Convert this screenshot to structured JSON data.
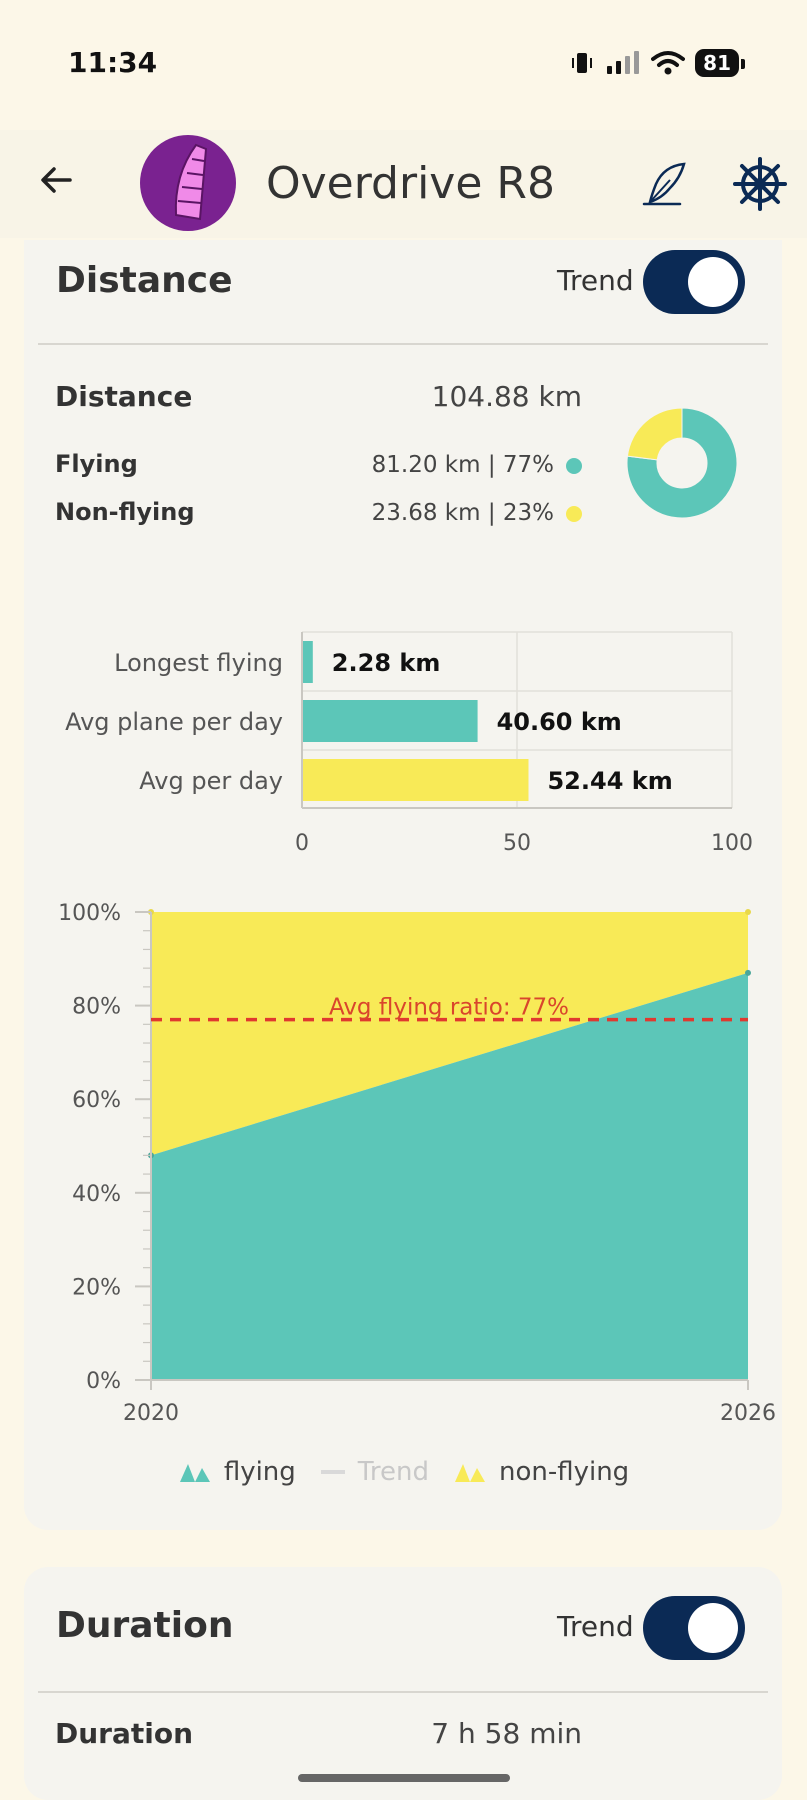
{
  "status_bar": {
    "time": "11:34",
    "battery": "81"
  },
  "app_bar": {
    "title": "Overdrive R8",
    "icons": [
      "back-arrow-icon",
      "kite-avatar",
      "quill-icon",
      "helm-icon"
    ]
  },
  "distance_card": {
    "title": "Distance",
    "trend_label": "Trend",
    "trend_on": true,
    "summary": {
      "total_label": "Distance",
      "total_value": "104.88 km",
      "flying_label": "Flying",
      "flying_value": "81.20 km | 77%",
      "nonflying_label": "Non-flying",
      "nonflying_value": "23.68 km | 23%"
    }
  },
  "duration_card": {
    "title": "Duration",
    "trend_label": "Trend",
    "trend_on": true,
    "total_label": "Duration",
    "total_value": "7 h 58 min"
  },
  "colors": {
    "flying": "#5cc6b8",
    "nonflying": "#f8ea57",
    "navy": "#0b2a55",
    "avg_line": "#e0392f"
  },
  "chart_data": [
    {
      "type": "pie",
      "labels": [
        "Flying",
        "Non-flying"
      ],
      "values": [
        77,
        23
      ]
    },
    {
      "type": "bar",
      "orientation": "horizontal",
      "categories": [
        "Longest flying",
        "Avg plane per day",
        "Avg per day"
      ],
      "values": [
        2.28,
        40.6,
        52.44
      ],
      "value_labels": [
        "2.28 km",
        "40.60 km",
        "52.44 km"
      ],
      "colors": [
        "#5cc6b8",
        "#5cc6b8",
        "#f8ea57"
      ],
      "xlim": [
        0,
        100
      ],
      "x_ticks": [
        "0",
        "50",
        "100"
      ]
    },
    {
      "type": "area",
      "stacked_percent": true,
      "x": [
        2020,
        2026
      ],
      "x_tick_labels": [
        "2020",
        "2026"
      ],
      "series": [
        {
          "name": "flying",
          "values": [
            48,
            87
          ]
        },
        {
          "name": "non-flying",
          "values": [
            52,
            13
          ]
        }
      ],
      "ylim": [
        0,
        100
      ],
      "y_tick_labels": [
        "0%",
        "20%",
        "40%",
        "60%",
        "80%",
        "100%"
      ],
      "annotation": {
        "text": "Avg flying ratio: 77%",
        "y": 77
      },
      "legend": [
        {
          "name": "flying",
          "enabled": true
        },
        {
          "name": "Trend",
          "enabled": false
        },
        {
          "name": "non-flying",
          "enabled": true
        }
      ]
    }
  ]
}
